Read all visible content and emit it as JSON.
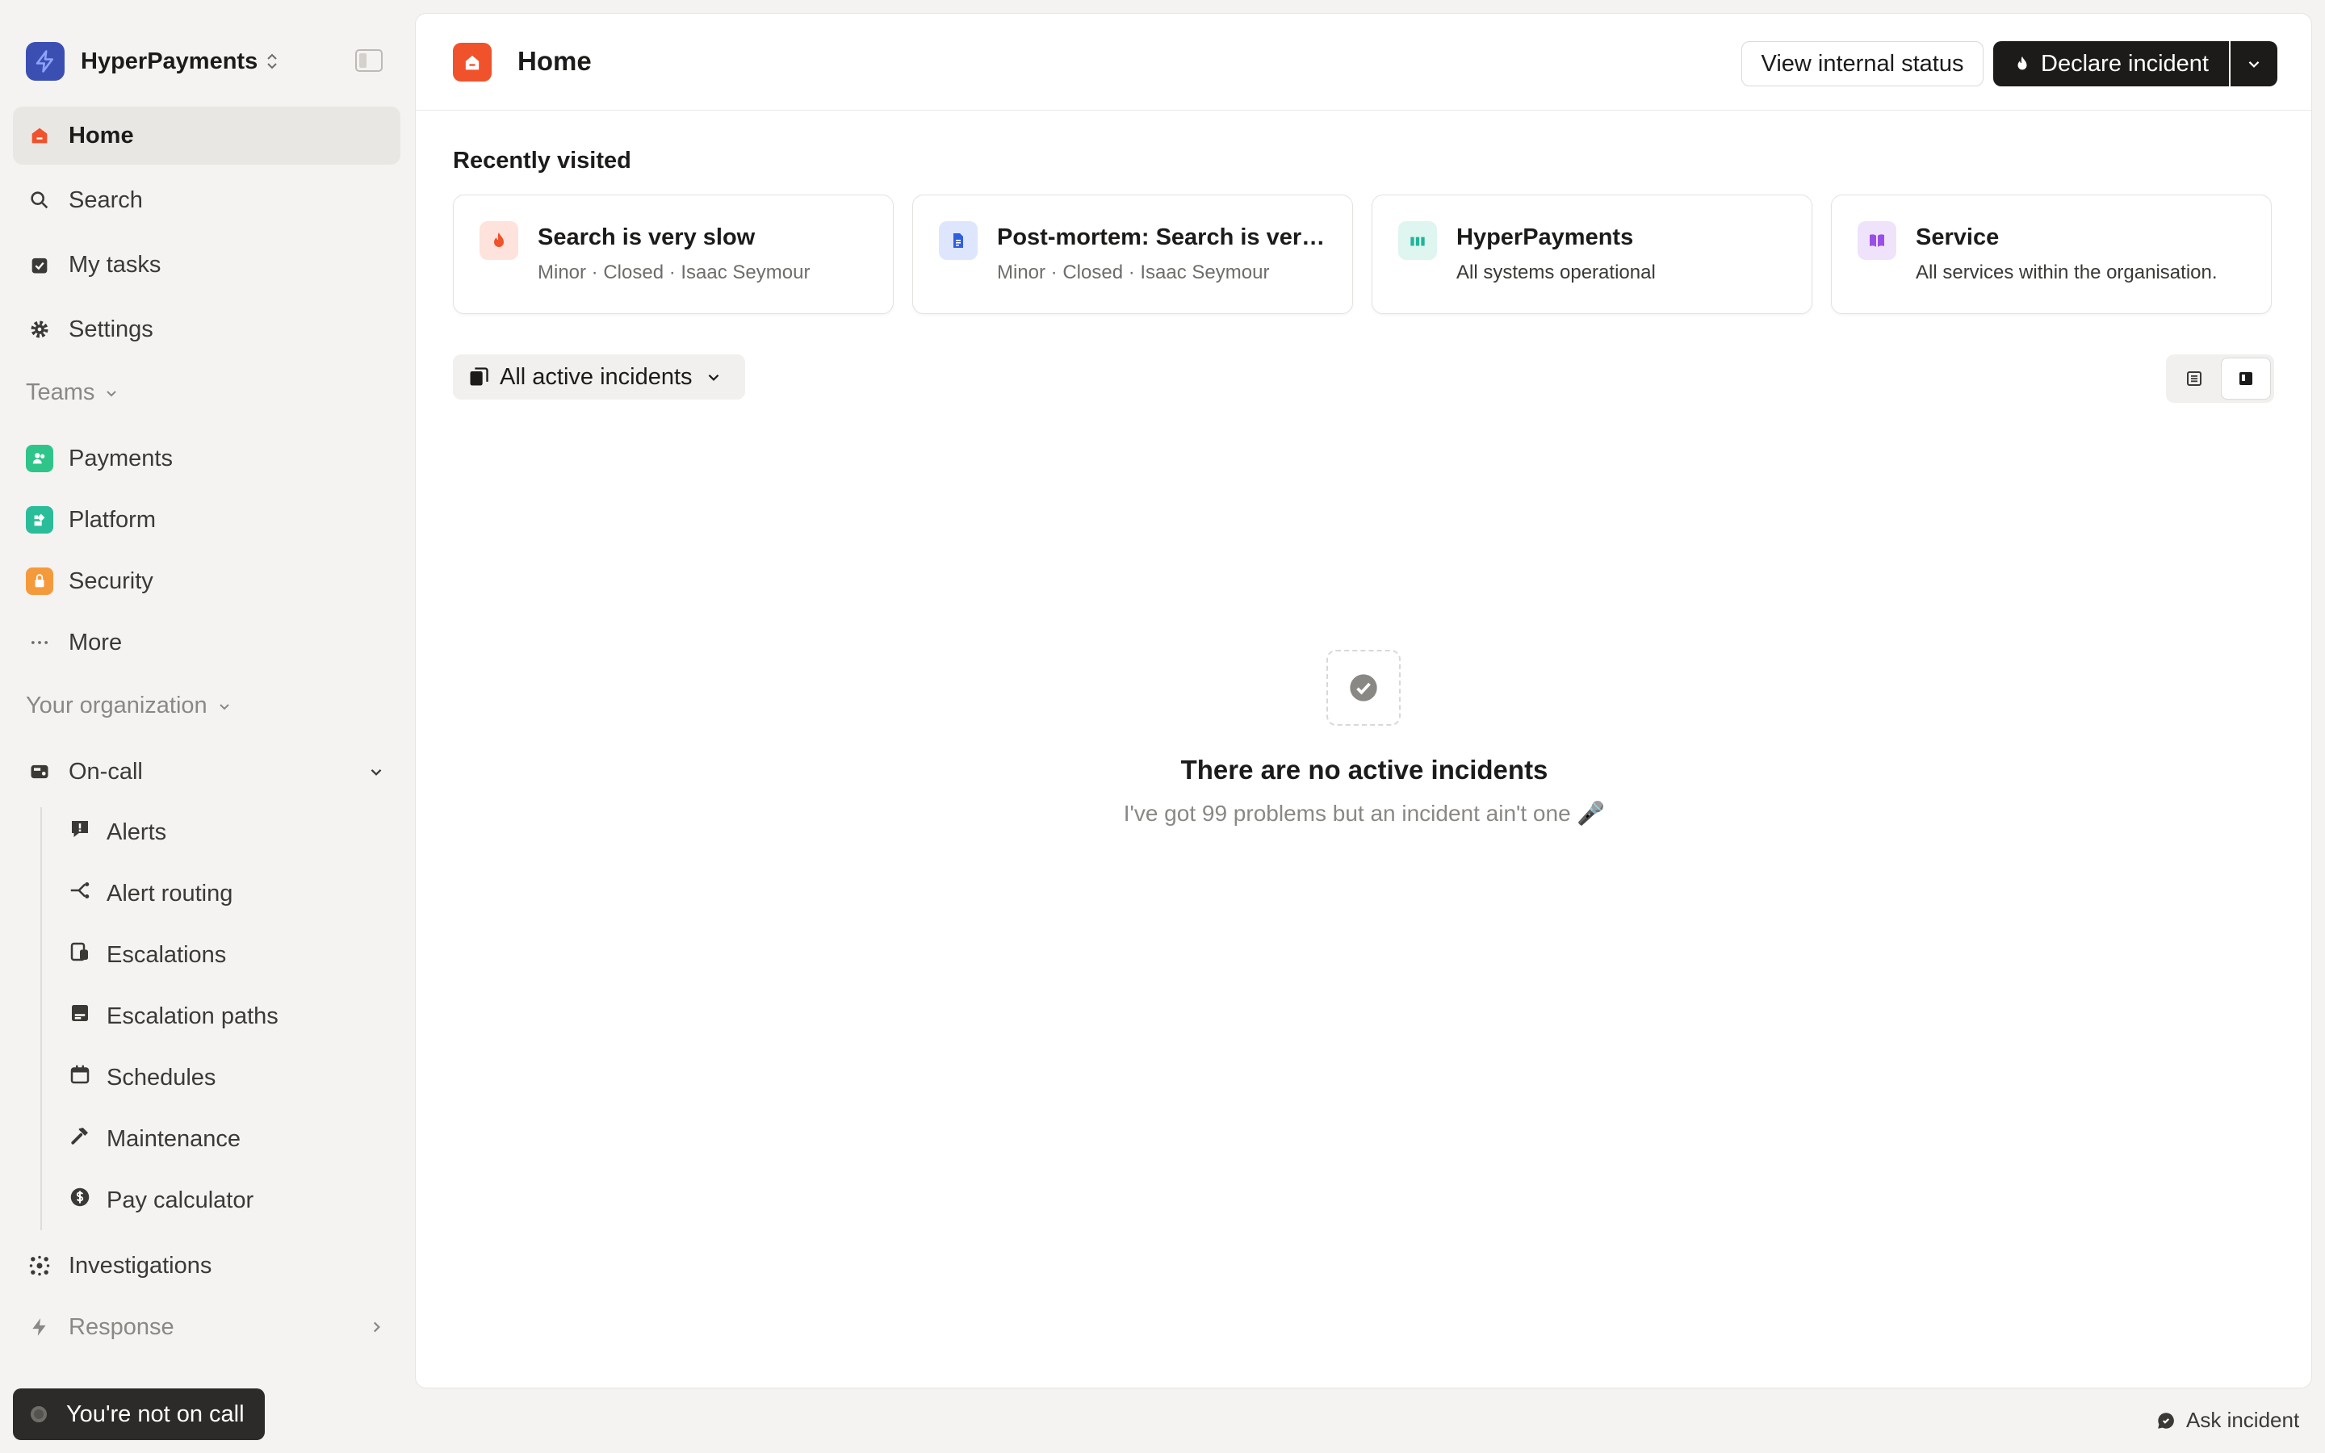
{
  "org": {
    "name": "HyperPayments",
    "caret_icon": "chevron-updown-icon"
  },
  "nav": {
    "home": "Home",
    "search": "Search",
    "my_tasks": "My tasks",
    "settings": "Settings"
  },
  "teams": {
    "label": "Teams",
    "items": [
      "Payments",
      "Platform",
      "Security"
    ],
    "more": "More"
  },
  "org_section": {
    "label": "Your organization"
  },
  "oncall": {
    "label": "On-call",
    "items": [
      "Alerts",
      "Alert routing",
      "Escalations",
      "Escalation paths",
      "Schedules",
      "Maintenance",
      "Pay calculator"
    ]
  },
  "investigations": "Investigations",
  "response": "Response",
  "oncall_status": "You're not on call",
  "header": {
    "title": "Home",
    "view_status": "View internal status",
    "declare": "Declare incident"
  },
  "recent": {
    "title": "Recently visited",
    "cards": [
      {
        "title": "Search is very slow",
        "subtitle": "Minor · Closed · Isaac Seymour",
        "icon": "flame-icon"
      },
      {
        "title": "Post-mortem: Search is very slow",
        "subtitle": "Minor · Closed · Isaac Seymour",
        "icon": "document-icon"
      },
      {
        "title": "HyperPayments",
        "subtitle": "All systems operational",
        "icon": "status-bars-icon"
      },
      {
        "title": "Service",
        "subtitle": "All services within the organisation.",
        "icon": "book-icon"
      }
    ]
  },
  "filter": {
    "label": "All active incidents"
  },
  "empty": {
    "title": "There are no active incidents",
    "subtitle": "I've got 99 problems but an incident ain't one 🎤"
  },
  "ask": "Ask incident",
  "colors": {
    "accent": "#f0522b",
    "dark": "#1c1b1a",
    "org": "#3b4fb3"
  }
}
